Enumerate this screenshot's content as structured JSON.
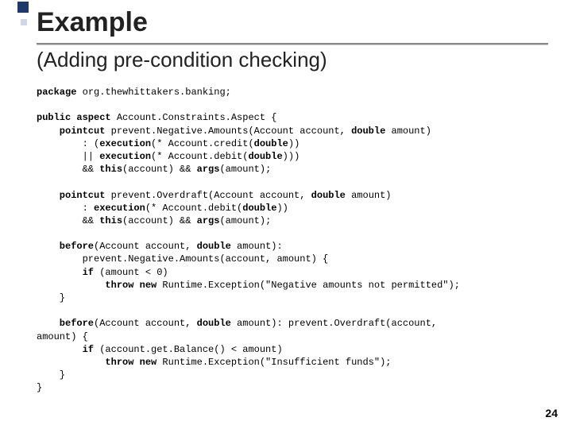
{
  "title": "Example",
  "subtitle": "(Adding pre-condition checking)",
  "page_number": "24",
  "code": {
    "l01a": "package",
    "l01b": " org.thewhittakers.banking;",
    "l02a": "public aspect",
    "l02b": " Account.Constraints.Aspect {",
    "l03a": "    pointcut",
    "l03b": " prevent.Negative.Amounts(Account account, ",
    "l03c": "double",
    "l03d": " amount)",
    "l04a": "        : (",
    "l04b": "execution",
    "l04c": "(* Account.credit(",
    "l04d": "double",
    "l04e": "))",
    "l05a": "        || ",
    "l05b": "execution",
    "l05c": "(* Account.debit(",
    "l05d": "double",
    "l05e": ")))",
    "l06a": "        && ",
    "l06b": "this",
    "l06c": "(account) && ",
    "l06d": "args",
    "l06e": "(amount);",
    "l07a": "    pointcut",
    "l07b": " prevent.Overdraft(Account account, ",
    "l07c": "double",
    "l07d": " amount)",
    "l08a": "        : ",
    "l08b": "execution",
    "l08c": "(* Account.debit(",
    "l08d": "double",
    "l08e": "))",
    "l09a": "        && ",
    "l09b": "this",
    "l09c": "(account) && ",
    "l09d": "args",
    "l09e": "(amount);",
    "l10a": "    before",
    "l10b": "(Account account, ",
    "l10c": "double",
    "l10d": " amount):",
    "l11": "        prevent.Negative.Amounts(account, amount) {",
    "l12a": "        if",
    "l12b": " (amount < 0)",
    "l13a": "            throw new",
    "l13b": " Runtime.Exception(\"Negative amounts not permitted\");",
    "l14": "    }",
    "l15a": "    before",
    "l15b": "(Account account, ",
    "l15c": "double",
    "l15d": " amount): prevent.Overdraft(account,",
    "l16": "amount) {",
    "l17a": "        if",
    "l17b": " (account.get.Balance() < amount)",
    "l18a": "            throw new",
    "l18b": " Runtime.Exception(\"Insufficient funds\");",
    "l19": "    }",
    "l20": "}"
  }
}
